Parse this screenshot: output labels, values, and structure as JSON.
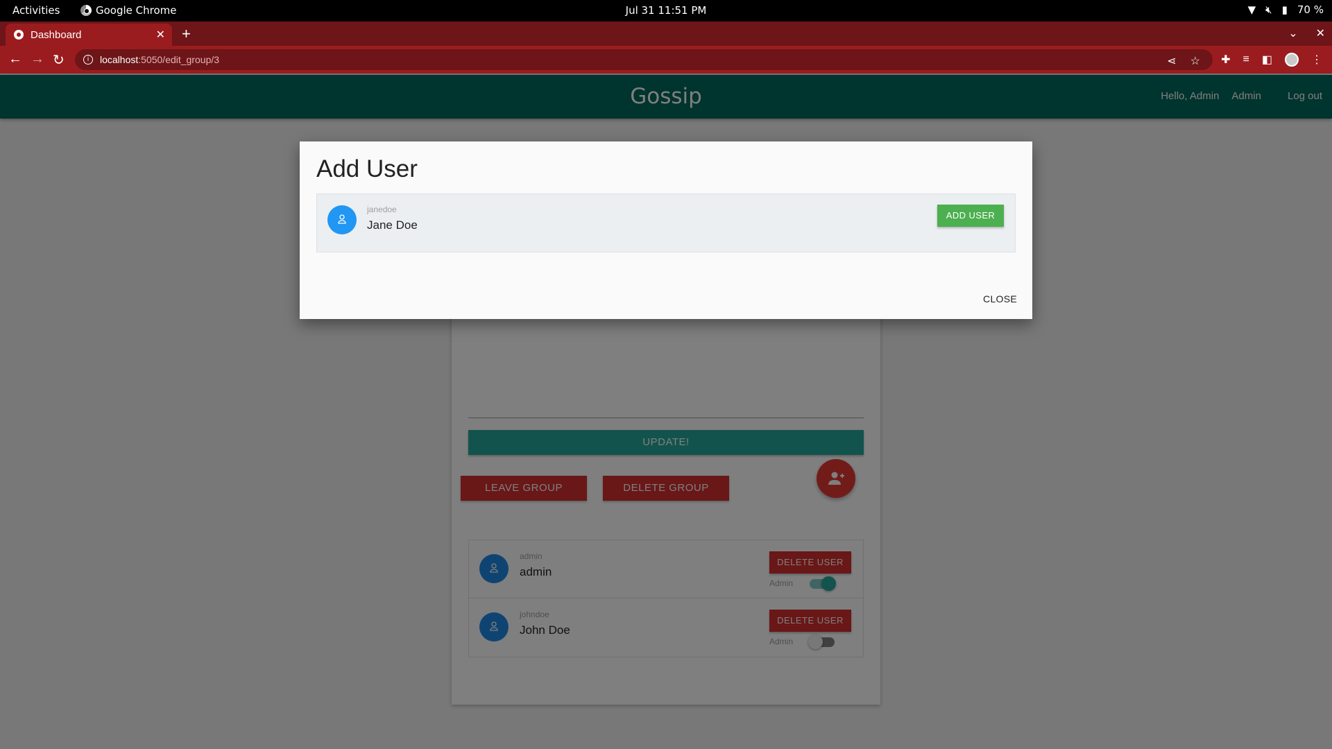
{
  "os": {
    "activities": "Activities",
    "app_name": "Google Chrome",
    "clock": "Jul 31  11:51 PM",
    "battery": "70 %"
  },
  "browser": {
    "tab_title": "Dashboard",
    "url_host": "localhost",
    "url_path": ":5050/edit_group/3",
    "theme_color": "#9b1c1f"
  },
  "header": {
    "brand": "Gossip",
    "greeting": "Hello, Admin",
    "admin_link": "Admin",
    "logout": "Log out",
    "color": "#00695c"
  },
  "group": {
    "update_label": "UPDATE!",
    "leave_label": "LEAVE GROUP",
    "delete_label": "DELETE GROUP",
    "members": [
      {
        "username": "admin",
        "name": "admin",
        "delete_label": "DELETE USER",
        "admin_label": "Admin",
        "is_admin": true
      },
      {
        "username": "johndoe",
        "name": "John Doe",
        "delete_label": "DELETE USER",
        "admin_label": "Admin",
        "is_admin": false
      }
    ]
  },
  "modal": {
    "title": "Add User",
    "candidates": [
      {
        "username": "janedoe",
        "name": "Jane Doe",
        "action_label": "ADD USER"
      }
    ],
    "close_label": "CLOSE"
  }
}
